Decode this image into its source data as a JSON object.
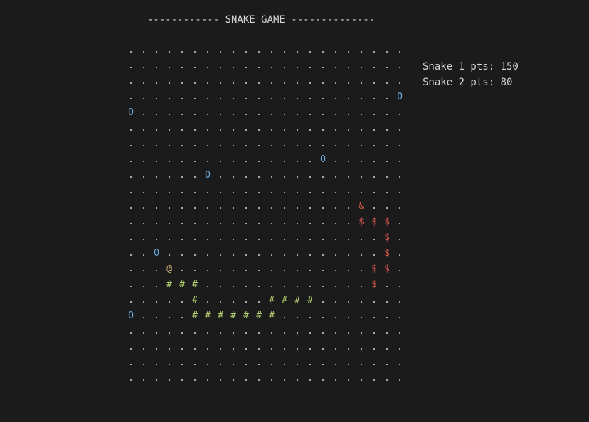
{
  "title": "------------ SNAKE GAME --------------",
  "scores": [
    {
      "label": "Snake 1 pts: 150"
    },
    {
      "label": "Snake 2 pts: 80"
    }
  ],
  "board": {
    "rows": [
      ". . . . . . . . . . . . . . . . . . . . . .",
      ". . . . . . . . . . . . . . . . . . . . . .",
      ". . . . . . . . . . . . . . . . . . . . . .",
      ". . . . . . . . . . . . . . . . . . . . . O",
      "O . . . . . . . . . . . . . . . . . . . . .",
      ". . . . . . . . . . . . . . . . . . . . . .",
      ". . . . . . . . . . . . . . . . . . . . . .",
      ". . . . . . . . . . . . . . . O . . . . . .",
      ". . . . . . O . . . . . . . . . . . . . . .",
      ". . . . . . . . . . . . . . . . . . . . . .",
      ". . . . . . . . . . . . . . . . . . & . . .",
      ". . . . . . . . . . . . . . . . . . $ $ $ .",
      ". . . . . . . . . . . . . . . . . . . . $ .",
      ". . O . . . . . . . . . . . . . . . . . $ .",
      ". . . @ . . . . . . . . . . . . . . . $ $ .",
      ". . . # # # . . . . . . . . . . . . . $ . .",
      ". . . . . # . . . . . # # # # . . . . . . .",
      "O . . . . # # # # # # # . . . . . . . . . .",
      ". . . . . . . . . . . . . . . . . . . . . .",
      ". . . . . . . . . . . . . . . . . . . . . .",
      ". . . . . . . . . . . . . . . . . . . . . .",
      ". . . . . . . . . . . . . . . . . . . . . ."
    ]
  },
  "colors": {
    "background": "#1b1b1b",
    "text": "#d4d4d4",
    "empty": "#c8c8c8",
    "food": "#6aa8d8",
    "snake1": "#b4cf6e",
    "snake1_head": "#d7ba7d",
    "snake2": "#d9574d",
    "snake2_head": "#d9574d"
  },
  "legend_icons": {
    "empty": "dot-icon",
    "food": "food-pellet-icon",
    "snake1_head": "snake1-head-icon",
    "snake1_body": "snake1-body-icon",
    "snake2_head": "snake2-head-icon",
    "snake2_body": "snake2-body-icon"
  }
}
